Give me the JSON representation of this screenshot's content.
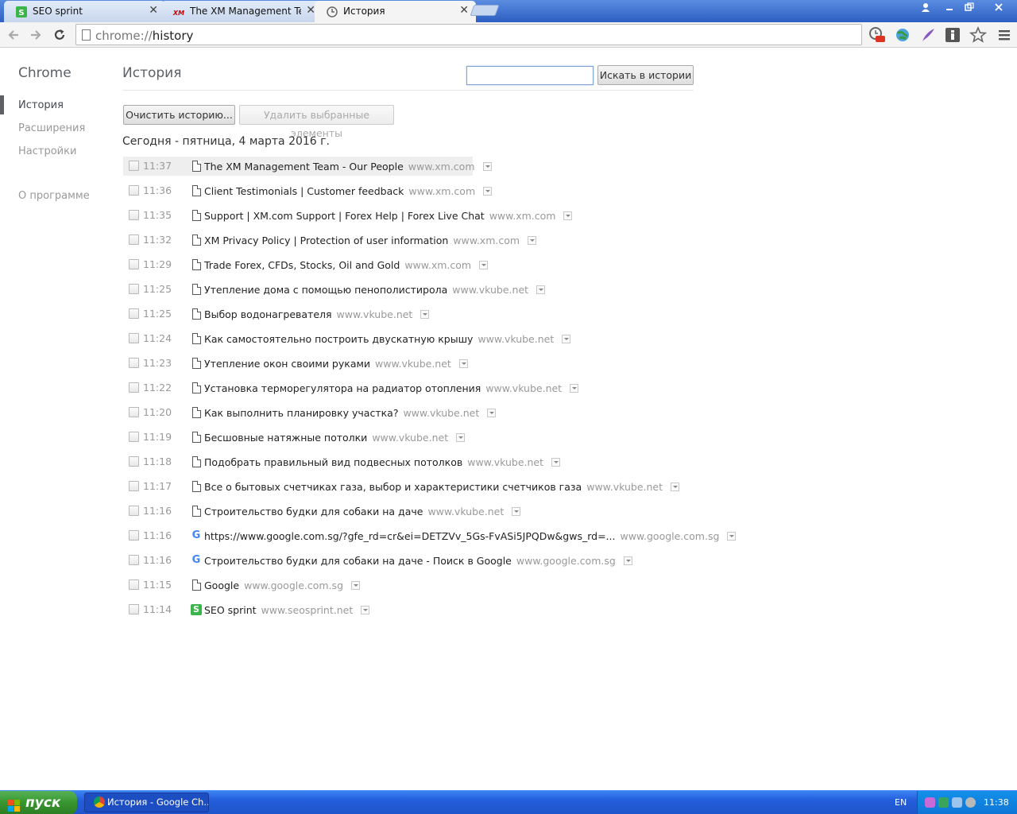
{
  "browser": {
    "tabs": [
      {
        "title": "SEO sprint",
        "icon": "seosprint-icon",
        "active": false
      },
      {
        "title": "The XM Management Team -",
        "icon": "xm-logo-icon",
        "active": false
      },
      {
        "title": "История",
        "icon": "history-clock-icon",
        "active": true
      }
    ],
    "close_glyph": "✕",
    "url_scheme": "chrome://",
    "url_path": "history"
  },
  "sidebar": {
    "brand": "Chrome",
    "items": [
      {
        "label": "История",
        "selected": true
      },
      {
        "label": "Расширения",
        "selected": false
      },
      {
        "label": "Настройки",
        "selected": false
      }
    ],
    "about": "О программе"
  },
  "main": {
    "title": "История",
    "search_value": "",
    "search_button": "Искать в истории",
    "clear_button": "Очистить историю...",
    "remove_button": "Удалить выбранные элементы",
    "date_header": "Сегодня - пятница, 4 марта 2016 г."
  },
  "entries": [
    {
      "time": "11:37",
      "title": "The XM Management Team - Our People",
      "domain": "www.xm.com",
      "icon": "page"
    },
    {
      "time": "11:36",
      "title": "Client Testimonials | Customer feedback",
      "domain": "www.xm.com",
      "icon": "page"
    },
    {
      "time": "11:35",
      "title": "Support | XM.com Support | Forex Help | Forex Live Chat",
      "domain": "www.xm.com",
      "icon": "page"
    },
    {
      "time": "11:32",
      "title": "XM Privacy Policy | Protection of user information",
      "domain": "www.xm.com",
      "icon": "page"
    },
    {
      "time": "11:29",
      "title": "Trade Forex, CFDs, Stocks, Oil and Gold",
      "domain": "www.xm.com",
      "icon": "page"
    },
    {
      "time": "11:25",
      "title": "Утепление дома с помощью пенополистирола",
      "domain": "www.vkube.net",
      "icon": "page"
    },
    {
      "time": "11:25",
      "title": "Выбор водонагревателя",
      "domain": "www.vkube.net",
      "icon": "page"
    },
    {
      "time": "11:24",
      "title": "Как самостоятельно построить двускатную крышу",
      "domain": "www.vkube.net",
      "icon": "page"
    },
    {
      "time": "11:23",
      "title": "Утепление окон своими руками",
      "domain": "www.vkube.net",
      "icon": "page"
    },
    {
      "time": "11:22",
      "title": "Установка терморегулятора на радиатор отопления",
      "domain": "www.vkube.net",
      "icon": "page"
    },
    {
      "time": "11:20",
      "title": "Как выполнить планировку участка?",
      "domain": "www.vkube.net",
      "icon": "page"
    },
    {
      "time": "11:19",
      "title": "Бесшовные натяжные потолки",
      "domain": "www.vkube.net",
      "icon": "page"
    },
    {
      "time": "11:18",
      "title": "Подобрать правильный вид подвесных потолков",
      "domain": "www.vkube.net",
      "icon": "page"
    },
    {
      "time": "11:17",
      "title": "Все о бытовых счетчиках газа, выбор и характеристики счетчиков газа",
      "domain": "www.vkube.net",
      "icon": "page"
    },
    {
      "time": "11:16",
      "title": "Строительство будки для собаки на даче",
      "domain": "www.vkube.net",
      "icon": "page"
    },
    {
      "time": "11:16",
      "title": "https://www.google.com.sg/?gfe_rd=cr&ei=DETZVv_5Gs-FvASi5JPQDw&gws_rd=...",
      "domain": "www.google.com.sg",
      "icon": "google"
    },
    {
      "time": "11:16",
      "title": "Строительство будки для собаки на даче - Поиск в Google",
      "domain": "www.google.com.sg",
      "icon": "google"
    },
    {
      "time": "11:15",
      "title": "Google",
      "domain": "www.google.com.sg",
      "icon": "page"
    },
    {
      "time": "11:14",
      "title": "SEO sprint",
      "domain": "www.seosprint.net",
      "icon": "seo"
    }
  ],
  "taskbar": {
    "start": "пуск",
    "task_title": "История - Google Ch...",
    "lang": "EN",
    "clock": "11:38"
  }
}
